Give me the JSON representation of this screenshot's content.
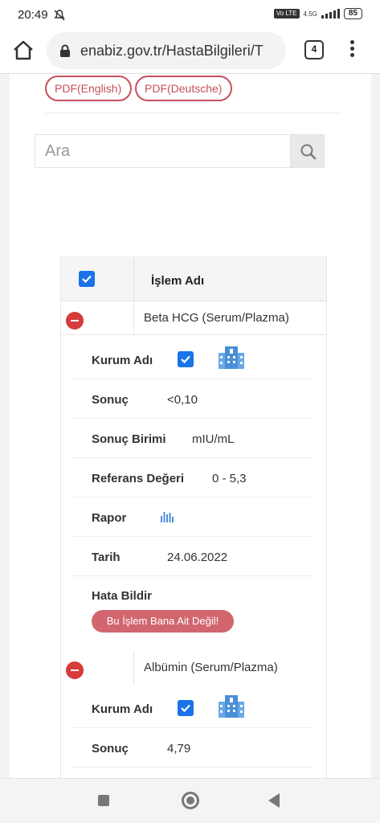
{
  "status_bar": {
    "time": "20:49",
    "volte": "Vo LTE",
    "network": "4.5G",
    "battery": "85"
  },
  "browser": {
    "url": "enabiz.gov.tr/HastaBilgileri/T",
    "tab_count": "4"
  },
  "page": {
    "pdf_buttons": [
      "PDF(English)",
      "PDF(Deutsche)"
    ],
    "search": {
      "placeholder": "Ara"
    },
    "table": {
      "header": "İşlem Adı",
      "labels": {
        "kurum": "Kurum Adı",
        "sonuc": "Sonuç",
        "birim": "Sonuç Birimi",
        "referans": "Referans Değeri",
        "rapor": "Rapor",
        "tarih": "Tarih",
        "hata": "Hata Bildir"
      },
      "error_button": "Bu İşlem Bana Ait Değil!",
      "rows": [
        {
          "name": "Beta HCG (Serum/Plazma)",
          "sonuc": "<0,10",
          "birim": "mIU/mL",
          "referans": "0 - 5,3",
          "tarih": "24.06.2022"
        },
        {
          "name": "Albümin (Serum/Plazma)",
          "sonuc": "4,79"
        }
      ]
    }
  },
  "colors": {
    "accent_red": "#d63a3a",
    "pdf_border": "#c7505c",
    "checkbox_blue": "#1a73e8",
    "hospital_icon": "#4a8fd6"
  }
}
